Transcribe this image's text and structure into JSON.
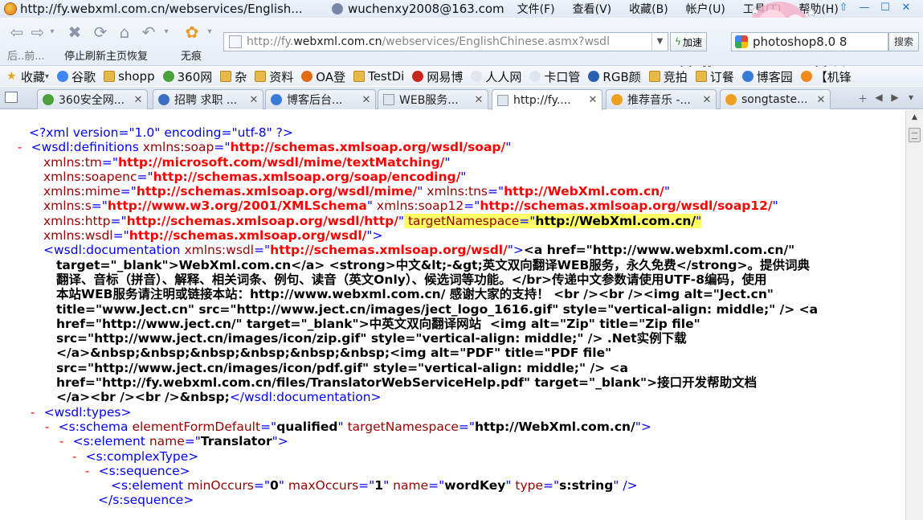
{
  "window": {
    "title": "http://fy.webxml.com.cn/webservices/English...",
    "account": "wuchenxy2008@163.com",
    "menu": [
      "文件(F)",
      "查看(V)",
      "收藏(B)",
      "帐户(U)",
      "工具(T)",
      "帮助(H)"
    ]
  },
  "toolbar": {
    "back_fwd_label": "后..前...",
    "nav_label": "停止刷新主页恢复",
    "traceless_label": "无痕",
    "address": {
      "prefix": "http://fy.",
      "domain": "webxml.com.cn",
      "suffix": "/webservices/EnglishChinese.asmx?wsdl"
    },
    "accelerate_label": "加速",
    "search_value": "photoshop8.0 8",
    "search_button": "搜索"
  },
  "favorites": [
    {
      "label": "收藏",
      "icon": "star-icon",
      "dropdown": true
    },
    {
      "label": "谷歌",
      "icon": "google-icon",
      "color": "#4285f4"
    },
    {
      "label": "shopp",
      "icon": "folder-icon"
    },
    {
      "label": "360网",
      "icon": "360-icon",
      "color": "#4aa13a"
    },
    {
      "label": "杂",
      "icon": "folder-icon"
    },
    {
      "label": "资料",
      "icon": "folder-icon"
    },
    {
      "label": "OA登",
      "icon": "oa-icon",
      "color": "#e06b12"
    },
    {
      "label": "TestDi",
      "icon": "folder-icon"
    },
    {
      "label": "网易博",
      "icon": "netease-icon",
      "color": "#c8281e"
    },
    {
      "label": "人人网",
      "icon": "page-icon",
      "color": "#dfe6ee"
    },
    {
      "label": "卡口管",
      "icon": "page-icon",
      "color": "#dfe6ee"
    },
    {
      "label": "RGB颜",
      "icon": "rgb-icon",
      "color": "#2a5fb0"
    },
    {
      "label": "竞拍",
      "icon": "folder-icon"
    },
    {
      "label": "订餐",
      "icon": "folder-icon"
    },
    {
      "label": "博客园",
      "icon": "cnblogs-icon",
      "color": "#3a7bd5"
    },
    {
      "label": "【机锋",
      "icon": "gfan-icon",
      "color": "#f08a1c"
    }
  ],
  "tabs": [
    {
      "label": "360安全网...",
      "color": "#4aa13a",
      "active": false
    },
    {
      "label": "招聘 求职 ...",
      "color": "#3a6fc4",
      "active": false
    },
    {
      "label": "博客后台...",
      "color": "#3a7bd5",
      "active": false
    },
    {
      "label": "WEB服务...",
      "color": "#dfe6ee",
      "active": false
    },
    {
      "label": "http://fy....",
      "color": "#dfe6ee",
      "active": true
    },
    {
      "label": "推荐音乐 -...",
      "color": "#f0a020",
      "active": false
    },
    {
      "label": "songtaste...",
      "color": "#f0a020",
      "active": false
    }
  ],
  "xml_lines": [
    {
      "indent": 36,
      "tokens": [
        [
          "pi",
          "<?xml version=\"1.0\" encoding=\"utf-8\" ?>"
        ]
      ]
    },
    {
      "indent": 20,
      "tokens": [
        [
          "m",
          "- "
        ],
        [
          "tg",
          "<wsdl:definitions "
        ],
        [
          "an",
          "xmlns:soap"
        ],
        [
          "tg",
          "=\""
        ],
        [
          "av",
          "http://schemas.xmlsoap.org/wsdl/soap/"
        ],
        [
          "tg",
          "\""
        ]
      ]
    },
    {
      "indent": 54,
      "tokens": [
        [
          "an",
          "xmlns:tm"
        ],
        [
          "tg",
          "=\""
        ],
        [
          "av",
          "http://microsoft.com/wsdl/mime/textMatching/"
        ],
        [
          "tg",
          "\""
        ]
      ]
    },
    {
      "indent": 54,
      "tokens": [
        [
          "an",
          "xmlns:soapenc"
        ],
        [
          "tg",
          "=\""
        ],
        [
          "av",
          "http://schemas.xmlsoap.org/soap/encoding/"
        ],
        [
          "tg",
          "\""
        ]
      ]
    },
    {
      "indent": 54,
      "tokens": [
        [
          "an",
          "xmlns:mime"
        ],
        [
          "tg",
          "=\""
        ],
        [
          "av",
          "http://schemas.xmlsoap.org/wsdl/mime/"
        ],
        [
          "tg",
          "\" "
        ],
        [
          "an",
          "xmlns:tns"
        ],
        [
          "tg",
          "=\""
        ],
        [
          "av",
          "http://WebXml.com.cn/"
        ],
        [
          "tg",
          "\""
        ]
      ]
    },
    {
      "indent": 54,
      "tokens": [
        [
          "an",
          "xmlns:s"
        ],
        [
          "tg",
          "=\""
        ],
        [
          "av",
          "http://www.w3.org/2001/XMLSchema"
        ],
        [
          "tg",
          "\" "
        ],
        [
          "an",
          "xmlns:soap12"
        ],
        [
          "tg",
          "=\""
        ],
        [
          "av",
          "http://schemas.xmlsoap.org/wsdl/soap12/"
        ],
        [
          "tg",
          "\""
        ]
      ]
    },
    {
      "indent": 54,
      "tokens": [
        [
          "an",
          "xmlns:http"
        ],
        [
          "tg",
          "=\""
        ],
        [
          "av",
          "http://schemas.xmlsoap.org/wsdl/http/"
        ],
        [
          "tg",
          "\""
        ],
        [
          "hl-an",
          " targetNamespace"
        ],
        [
          "hl-tg",
          "=\""
        ],
        [
          "hl-avb",
          "http://WebXml.com.cn/"
        ],
        [
          "hl-tg",
          "\""
        ]
      ]
    },
    {
      "indent": 54,
      "tokens": [
        [
          "an",
          "xmlns:wsdl"
        ],
        [
          "tg",
          "=\""
        ],
        [
          "av",
          "http://schemas.xmlsoap.org/wsdl/"
        ],
        [
          "tg",
          "\">"
        ]
      ]
    },
    {
      "indent": 54,
      "tokens": [
        [
          "tg",
          "<wsdl:documentation "
        ],
        [
          "an",
          "xmlns:wsdl"
        ],
        [
          "tg",
          "=\""
        ],
        [
          "av",
          "http://schemas.xmlsoap.org/wsdl/"
        ],
        [
          "tg",
          "\">"
        ],
        [
          "tx",
          "<a href=\"http://www.webxml.com.cn/\""
        ]
      ]
    },
    {
      "indent": 70,
      "tokens": [
        [
          "tx",
          "target=\"_blank\">WebXml.com.cn</a> <strong>中文&lt;-&gt;英文双向翻译WEB服务，永久免费</strong>。提供词典"
        ]
      ]
    },
    {
      "indent": 70,
      "tokens": [
        [
          "tx",
          "翻译、音标（拼音）、解释、相关词条、例句、读音（英文Only）、候选词等功能。</br>传递中文参数请使用UTF-8编码，使用"
        ]
      ]
    },
    {
      "indent": 70,
      "tokens": [
        [
          "tx",
          "本站WEB服务请注明或链接本站：http://www.webxml.com.cn/ 感谢大家的支持！ <br /><br /><img alt=\"Ject.cn\""
        ]
      ]
    },
    {
      "indent": 70,
      "tokens": [
        [
          "tx",
          "title=\"www.Ject.cn\" src=\"http://www.ject.cn/images/ject_logo_1616.gif\" style=\"vertical-align: middle;\" /> <a"
        ]
      ]
    },
    {
      "indent": 70,
      "tokens": [
        [
          "tx",
          "href=\"http://www.ject.cn/\" target=\"_blank\">中英文双向翻译网站  <img alt=\"Zip\" title=\"Zip file\""
        ]
      ]
    },
    {
      "indent": 70,
      "tokens": [
        [
          "tx",
          "src=\"http://www.ject.cn/images/icon/zip.gif\" style=\"vertical-align: middle;\" /> .Net实例下载"
        ]
      ]
    },
    {
      "indent": 70,
      "tokens": [
        [
          "tx",
          "</a>&nbsp;&nbsp;&nbsp;&nbsp;&nbsp;&nbsp;<img alt=\"PDF\" title=\"PDF file\""
        ]
      ]
    },
    {
      "indent": 70,
      "tokens": [
        [
          "tx",
          "src=\"http://www.ject.cn/images/icon/pdf.gif\" style=\"vertical-align: middle;\" /> <a"
        ]
      ]
    },
    {
      "indent": 70,
      "tokens": [
        [
          "tx",
          "href=\"http://fy.webxml.com.cn/files/TranslatorWebServiceHelp.pdf\" target=\"_blank\">接口开发帮助文档"
        ]
      ]
    },
    {
      "indent": 70,
      "tokens": [
        [
          "tx",
          "</a><br /><br />&nbsp;"
        ],
        [
          "tg",
          "</wsdl:documentation>"
        ]
      ]
    },
    {
      "indent": 36,
      "tokens": [
        [
          "m",
          "- "
        ],
        [
          "tg",
          "<wsdl:types>"
        ]
      ]
    },
    {
      "indent": 54,
      "tokens": [
        [
          "m",
          "- "
        ],
        [
          "tg",
          "<s:schema "
        ],
        [
          "an",
          "elementFormDefault"
        ],
        [
          "tg",
          "=\""
        ],
        [
          "avb",
          "qualified"
        ],
        [
          "tg",
          "\" "
        ],
        [
          "an",
          "targetNamespace"
        ],
        [
          "tg",
          "=\""
        ],
        [
          "avb",
          "http://WebXml.com.cn/"
        ],
        [
          "tg",
          "\">"
        ]
      ]
    },
    {
      "indent": 72,
      "tokens": [
        [
          "m",
          "- "
        ],
        [
          "tg",
          "<s:element "
        ],
        [
          "an",
          "name"
        ],
        [
          "tg",
          "=\""
        ],
        [
          "avb",
          "Translator"
        ],
        [
          "tg",
          "\">"
        ]
      ]
    },
    {
      "indent": 88,
      "tokens": [
        [
          "m",
          "- "
        ],
        [
          "tg",
          "<s:complexType>"
        ]
      ]
    },
    {
      "indent": 104,
      "tokens": [
        [
          "m",
          "- "
        ],
        [
          "tg",
          "<s:sequence>"
        ]
      ]
    },
    {
      "indent": 138,
      "tokens": [
        [
          "tg",
          "<s:element "
        ],
        [
          "an",
          "minOccurs"
        ],
        [
          "tg",
          "=\""
        ],
        [
          "avb",
          "0"
        ],
        [
          "tg",
          "\" "
        ],
        [
          "an",
          "maxOccurs"
        ],
        [
          "tg",
          "=\""
        ],
        [
          "avb",
          "1"
        ],
        [
          "tg",
          "\" "
        ],
        [
          "an",
          "name"
        ],
        [
          "tg",
          "=\""
        ],
        [
          "avb",
          "wordKey"
        ],
        [
          "tg",
          "\" "
        ],
        [
          "an",
          "type"
        ],
        [
          "tg",
          "=\""
        ],
        [
          "avb",
          "s:string"
        ],
        [
          "tg",
          "\" />"
        ]
      ]
    },
    {
      "indent": 122,
      "tokens": [
        [
          "tg",
          "</s:sequence>"
        ]
      ]
    }
  ]
}
